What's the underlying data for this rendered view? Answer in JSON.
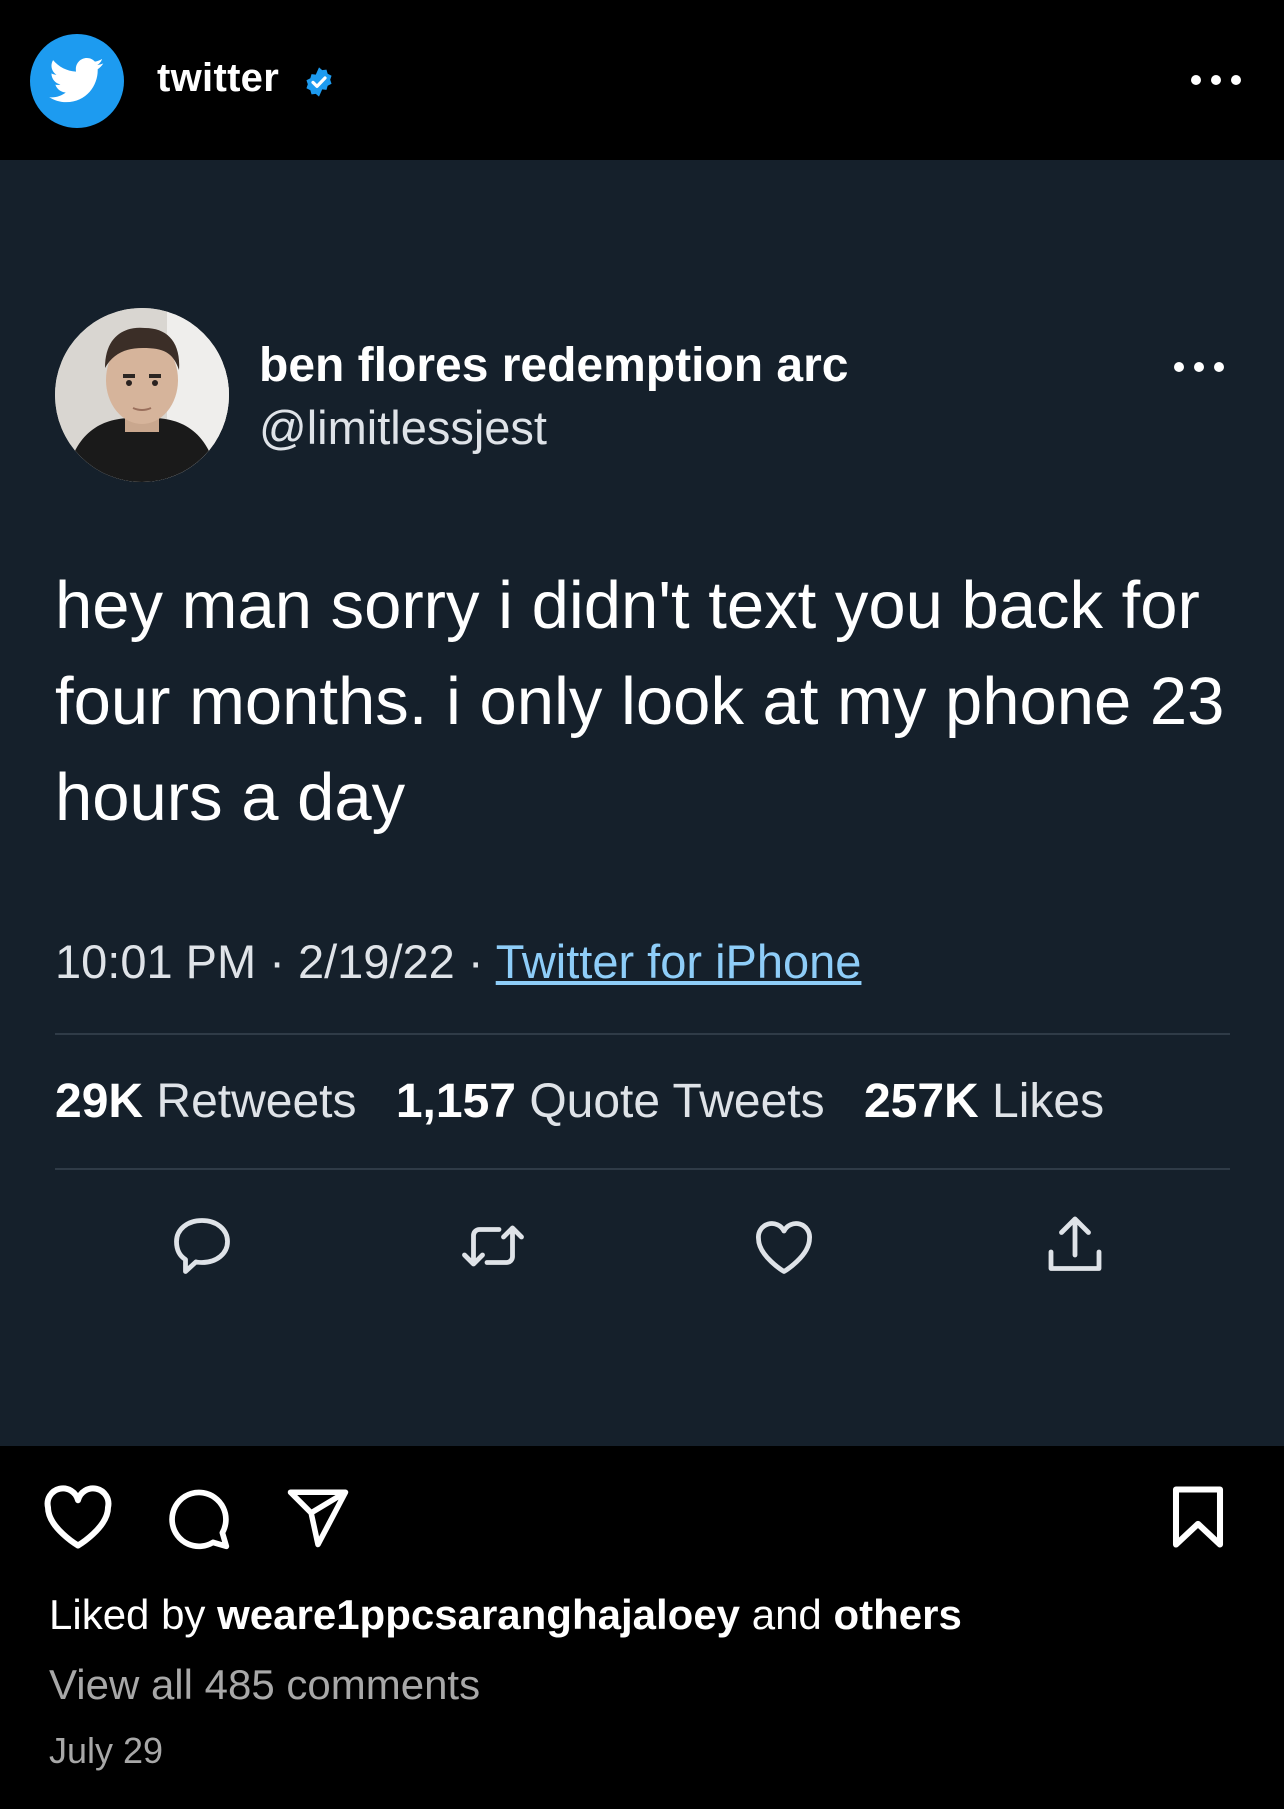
{
  "post_header": {
    "username": "twitter",
    "verified_icon": "verified-badge-icon",
    "avatar_icon": "twitter-bird-icon",
    "more_icon": "more-horizontal-icon"
  },
  "tweet": {
    "display_name": "ben flores redemption arc",
    "handle": "@limitlessjest",
    "text": "hey man sorry i didn't text you back for four months. i only look at my phone 23 hours a day",
    "time": "10:01 PM",
    "separator": "·",
    "date": "2/19/22",
    "source": "Twitter for iPhone",
    "stats": {
      "retweets_count": "29K",
      "retweets_label": "Retweets",
      "quotes_count": "1,157",
      "quotes_label": "Quote Tweets",
      "likes_count": "257K",
      "likes_label": "Likes"
    },
    "actions": [
      "reply-icon",
      "retweet-icon",
      "like-icon",
      "share-icon"
    ]
  },
  "post_footer": {
    "liked_prefix": "Liked by",
    "liked_user": "weare1ppcsaranghajaloey",
    "liked_and": "and",
    "liked_others": "others",
    "view_comments": "View all 485 comments",
    "date": "July 29",
    "actions": [
      "heart-icon",
      "comment-icon",
      "send-icon",
      "bookmark-icon"
    ]
  },
  "colors": {
    "page_background": "#000000",
    "tweet_background": "#15202b",
    "twitter_blue": "#1d9bf0",
    "link": "#8ecdf8",
    "secondary_text": "#a8a8a8"
  }
}
